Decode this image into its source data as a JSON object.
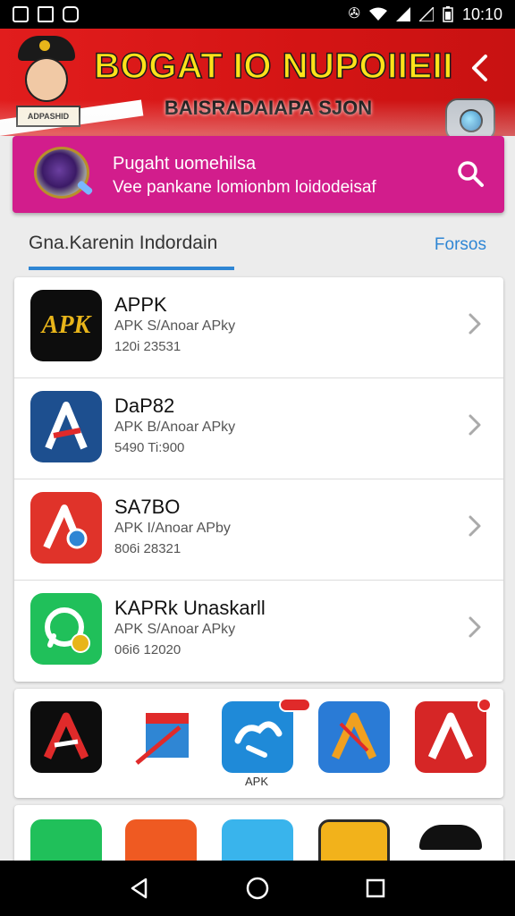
{
  "status_bar": {
    "time": "10:10",
    "left_icons": [
      "notification-icon",
      "photo-icon",
      "app-icon"
    ],
    "right_icons": [
      "vibrate-icon",
      "wifi-icon",
      "signal-icon",
      "no-signal-icon",
      "battery-icon"
    ]
  },
  "banner": {
    "title": "BOGAT IO NUPOIIEII",
    "subtitle": "BAISRADAIAPA SJON",
    "mascot_sign": "ADPASHID",
    "back_icon": "chevron-left-icon"
  },
  "search": {
    "title": "Pugaht uomehilsa",
    "subtitle": "Vee pankane lomionbm loidodeisaf",
    "icon": "search-icon"
  },
  "tabs": {
    "active": "Gna.Karenin Indordain",
    "link": "Forsos"
  },
  "apps": [
    {
      "name": "APPK",
      "subtitle": "APK S/Anoar APky",
      "meta": "120i 23531",
      "icon_text": "APK"
    },
    {
      "name": "DaP82",
      "subtitle": "APK B/Anoar APky",
      "meta": "5490 Ti:900",
      "icon_text": "A"
    },
    {
      "name": "SA7BO",
      "subtitle": "APK I/Anoar APby",
      "meta": "806i 28321",
      "icon_text": "A"
    },
    {
      "name": "KAPRk Unaskarll",
      "subtitle": "APK S/Anoar APky",
      "meta": "06i6 12020",
      "icon_text": ""
    }
  ],
  "grid": {
    "label": "APK"
  },
  "colors": {
    "banner_red": "#d41414",
    "title_yellow": "#ffe21a",
    "search_magenta": "#d21d8c",
    "accent_blue": "#2f86d4"
  },
  "nav_icons": [
    "back-triangle-icon",
    "home-circle-icon",
    "recents-square-icon"
  ]
}
